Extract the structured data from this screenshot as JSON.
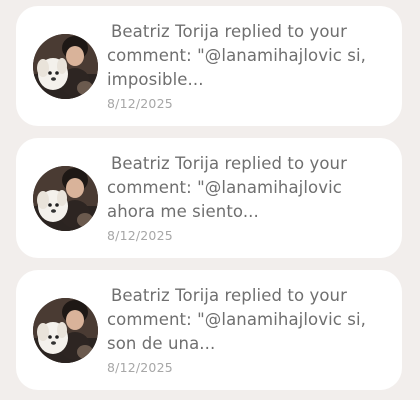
{
  "notifications": [
    {
      "message": "Beatriz Torija replied to your comment: \"@lanamihajlovic si, imposible...",
      "date": "8/12/2025",
      "avatar_icon": "user-avatar-photo"
    },
    {
      "message": "Beatriz Torija replied to your comment: \"@lanamihajlovic ahora me siento...",
      "date": "8/12/2025",
      "avatar_icon": "user-avatar-photo"
    },
    {
      "message": "Beatriz Torija replied to your comment: \"@lanamihajlovic si, son de una...",
      "date": "8/12/2025",
      "avatar_icon": "user-avatar-photo"
    }
  ]
}
